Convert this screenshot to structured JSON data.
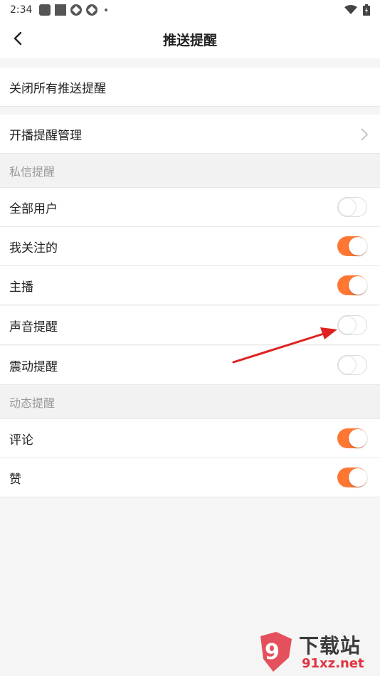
{
  "status_bar": {
    "time": "2:34"
  },
  "header": {
    "title": "推送提醒"
  },
  "rows": {
    "close_all": "关闭所有推送提醒",
    "live_reminder": "开播提醒管理"
  },
  "private_message": {
    "section_label": "私信提醒",
    "items": [
      {
        "label": "全部用户",
        "enabled": false
      },
      {
        "label": "我关注的",
        "enabled": true
      },
      {
        "label": "主播",
        "enabled": true
      },
      {
        "label": "声音提醒",
        "enabled": false
      },
      {
        "label": "震动提醒",
        "enabled": false
      }
    ]
  },
  "dynamic": {
    "section_label": "动态提醒",
    "items": [
      {
        "label": "评论",
        "enabled": true
      },
      {
        "label": "赞",
        "enabled": true
      }
    ]
  },
  "colors": {
    "accent": "#ff7733",
    "annotation": "#e02020"
  },
  "watermark": {
    "top_text": "下载站",
    "bottom_text": "91xz.net"
  }
}
